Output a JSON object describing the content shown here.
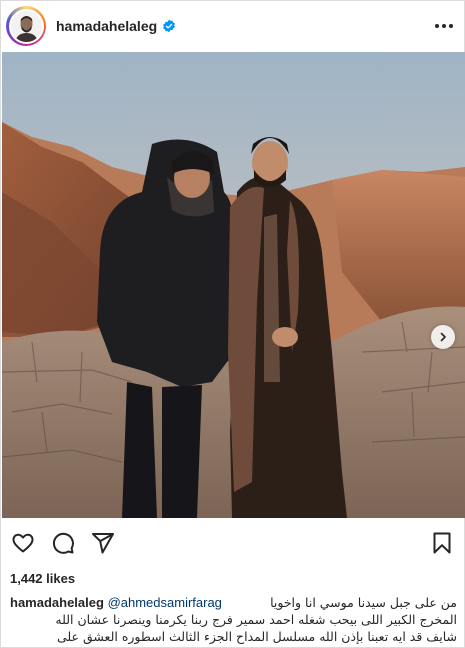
{
  "post": {
    "username": "hamadahelaleg",
    "verified": true,
    "likes": "1,442 likes",
    "carousel": {
      "total": 2,
      "active": 1
    },
    "caption": {
      "mention": "@ahmedsamirfarag",
      "line1_arabic": "من على جبل سيدنا موسي انا واخويا",
      "line2_arabic": "المخرج الكبير اللى بيحب شغله احمد سمير فرج ربنا يكرمنا وينصرنا عشان الله",
      "line3_arabic": "شايف قد ايه تعبنا بإذن الله مسلسل المداح الجزء الثالث اسطوره العشق على"
    }
  },
  "icons": {
    "more": "more-horizontal-icon",
    "verified": "verified-badge-icon",
    "like": "heart-icon",
    "comment": "comment-icon",
    "share": "paper-plane-icon",
    "save": "bookmark-icon",
    "next": "chevron-right-icon"
  },
  "colors": {
    "verified_blue": "#0095f6",
    "mention": "#00376b",
    "text": "#262626"
  }
}
